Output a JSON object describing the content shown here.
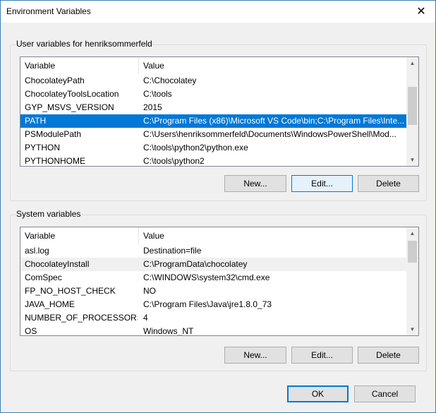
{
  "window": {
    "title": "Environment Variables"
  },
  "user_vars": {
    "group_label": "User variables for henriksommerfeld",
    "columns": {
      "variable": "Variable",
      "value": "Value"
    },
    "rows": [
      {
        "name": "ChocolateyPath",
        "value": "C:\\Chocolatey"
      },
      {
        "name": "ChocolateyToolsLocation",
        "value": "C:\\tools"
      },
      {
        "name": "GYP_MSVS_VERSION",
        "value": "2015"
      },
      {
        "name": "PATH",
        "value": "C:\\Program Files (x86)\\Microsoft VS Code\\bin;C:\\Program Files\\Inte..."
      },
      {
        "name": "PSModulePath",
        "value": "C:\\Users\\henriksommerfeld\\Documents\\WindowsPowerShell\\Mod..."
      },
      {
        "name": "PYTHON",
        "value": "C:\\tools\\python2\\python.exe"
      },
      {
        "name": "PYTHONHOME",
        "value": "C:\\tools\\python2"
      }
    ],
    "selected_index": 3,
    "buttons": {
      "new": "New...",
      "edit": "Edit...",
      "delete": "Delete"
    }
  },
  "system_vars": {
    "group_label": "System variables",
    "columns": {
      "variable": "Variable",
      "value": "Value"
    },
    "rows": [
      {
        "name": "asl.log",
        "value": "Destination=file"
      },
      {
        "name": "ChocolateyInstall",
        "value": "C:\\ProgramData\\chocolatey"
      },
      {
        "name": "ComSpec",
        "value": "C:\\WINDOWS\\system32\\cmd.exe"
      },
      {
        "name": "FP_NO_HOST_CHECK",
        "value": "NO"
      },
      {
        "name": "JAVA_HOME",
        "value": "C:\\Program Files\\Java\\jre1.8.0_73"
      },
      {
        "name": "NUMBER_OF_PROCESSORS",
        "value": "4"
      },
      {
        "name": "OS",
        "value": "Windows_NT"
      }
    ],
    "highlighted_index": 1,
    "buttons": {
      "new": "New...",
      "edit": "Edit...",
      "delete": "Delete"
    }
  },
  "dialog_buttons": {
    "ok": "OK",
    "cancel": "Cancel"
  },
  "icons": {
    "close": "close-icon",
    "scroll_up": "chevron-up-icon",
    "scroll_down": "chevron-down-icon"
  },
  "colors": {
    "selection": "#0078d7",
    "accent_border": "#0078d7"
  }
}
